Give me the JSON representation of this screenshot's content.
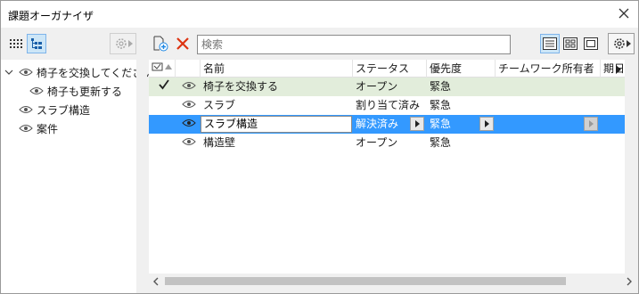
{
  "window": {
    "title": "課題オーガナイザ"
  },
  "left_tree": {
    "items": [
      {
        "label": "椅子を交換してください",
        "expanded": true
      },
      {
        "label": "椅子も更新する"
      },
      {
        "label": "スラブ構造"
      },
      {
        "label": "案件"
      }
    ]
  },
  "search": {
    "placeholder": "検索"
  },
  "grid": {
    "columns": [
      "名前",
      "ステータス",
      "優先度",
      "チームワーク所有者",
      "期日"
    ],
    "rows": [
      {
        "done": true,
        "name": "椅子を交換する",
        "status": "オープン",
        "priority": "緊急",
        "owner": ""
      },
      {
        "done": false,
        "name": "スラブ",
        "status": "割り当て済み",
        "priority": "緊急",
        "owner": ""
      },
      {
        "done": false,
        "name": "スラブ構造",
        "status": "解決済み",
        "priority": "緊急",
        "owner": "",
        "selected": true
      },
      {
        "done": false,
        "name": "構造壁",
        "status": "オープン",
        "priority": "緊急",
        "owner": ""
      }
    ]
  },
  "colors": {
    "selection": "#3399ff",
    "completed_row": "#e2eddb",
    "close_icon": "#dd3311"
  },
  "icons": {
    "close": "close-icon",
    "eye": "eye-icon",
    "checkmark": "checkmark-icon",
    "settings": "gear-icon"
  }
}
